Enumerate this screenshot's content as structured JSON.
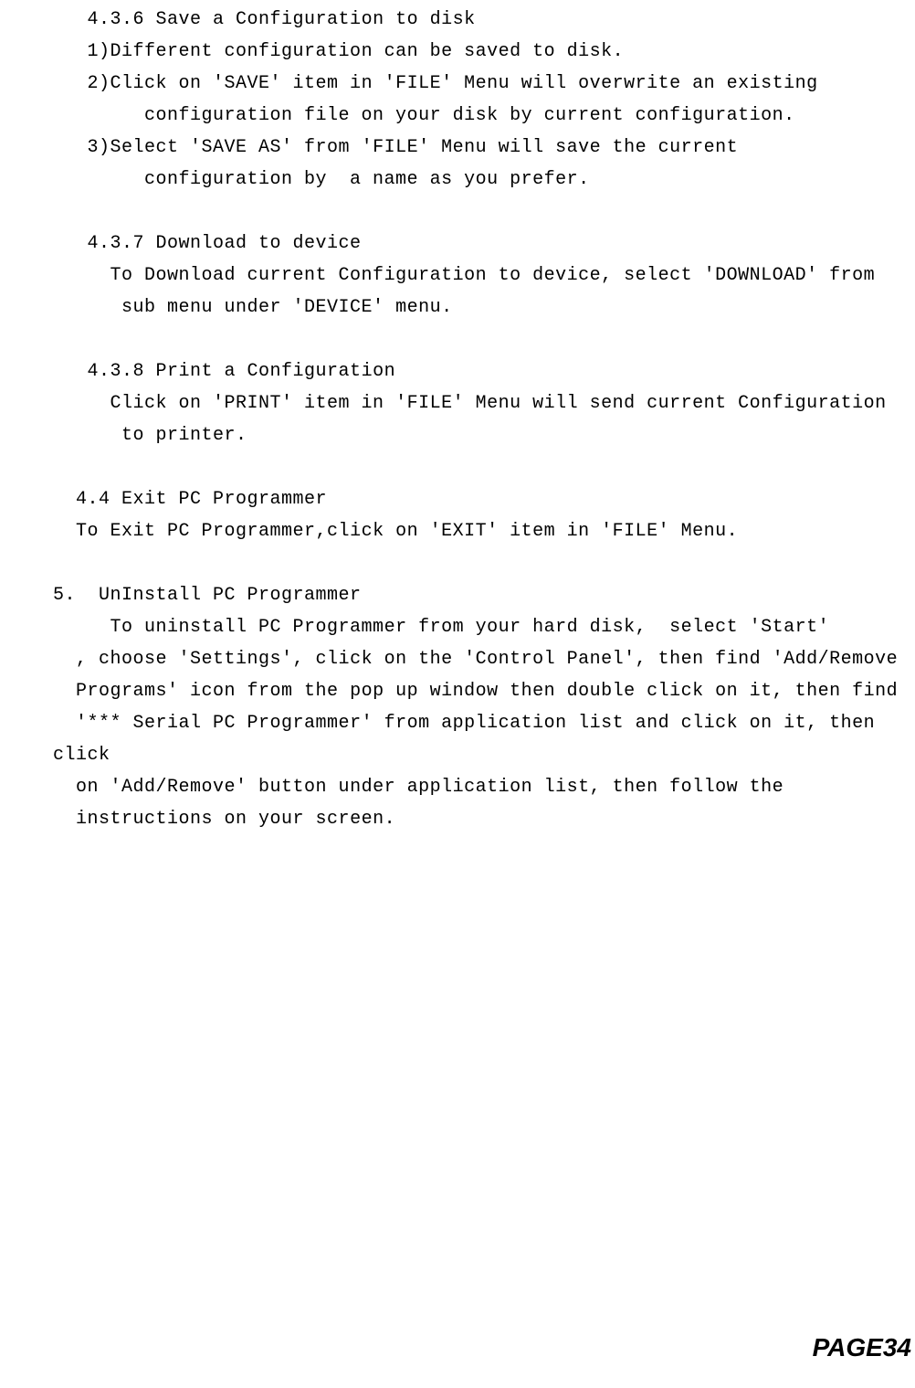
{
  "section_436": {
    "heading": "   4.3.6 Save a Configuration to disk",
    "line1": "   1)Different configuration can be saved to disk.",
    "line2": "   2)Click on 'SAVE' item in 'FILE' Menu will overwrite an existing",
    "line3": "        configuration file on your disk by current configuration.",
    "line4": "   3)Select 'SAVE AS' from 'FILE' Menu will save the current",
    "line5": "        configuration by  a name as you prefer."
  },
  "section_437": {
    "heading": "   4.3.7 Download to device",
    "line1": "     To Download current Configuration to device, select 'DOWNLOAD' from",
    "line2": "      sub menu under 'DEVICE' menu."
  },
  "section_438": {
    "heading": "   4.3.8 Print a Configuration",
    "line1": "     Click on 'PRINT' item in 'FILE' Menu will send current Configuration",
    "line2": "      to printer."
  },
  "section_44": {
    "heading": "  4.4 Exit PC Programmer",
    "line1": "  To Exit PC Programmer,click on 'EXIT' item in 'FILE' Menu."
  },
  "section_5": {
    "heading": "5.  UnInstall PC Programmer",
    "line1": "     To uninstall PC Programmer from your hard disk,  select 'Start'",
    "line2": "  , choose 'Settings', click on the 'Control Panel', then find 'Add/Remove",
    "line3": "  Programs' icon from the pop up window then double click on it, then find",
    "line4": "  '*** Serial PC Programmer' from application list and click on it, then click",
    "line5": "  on 'Add/Remove' button under application list, then follow the",
    "line6": "  instructions on your screen."
  },
  "page_number": "PAGE34"
}
